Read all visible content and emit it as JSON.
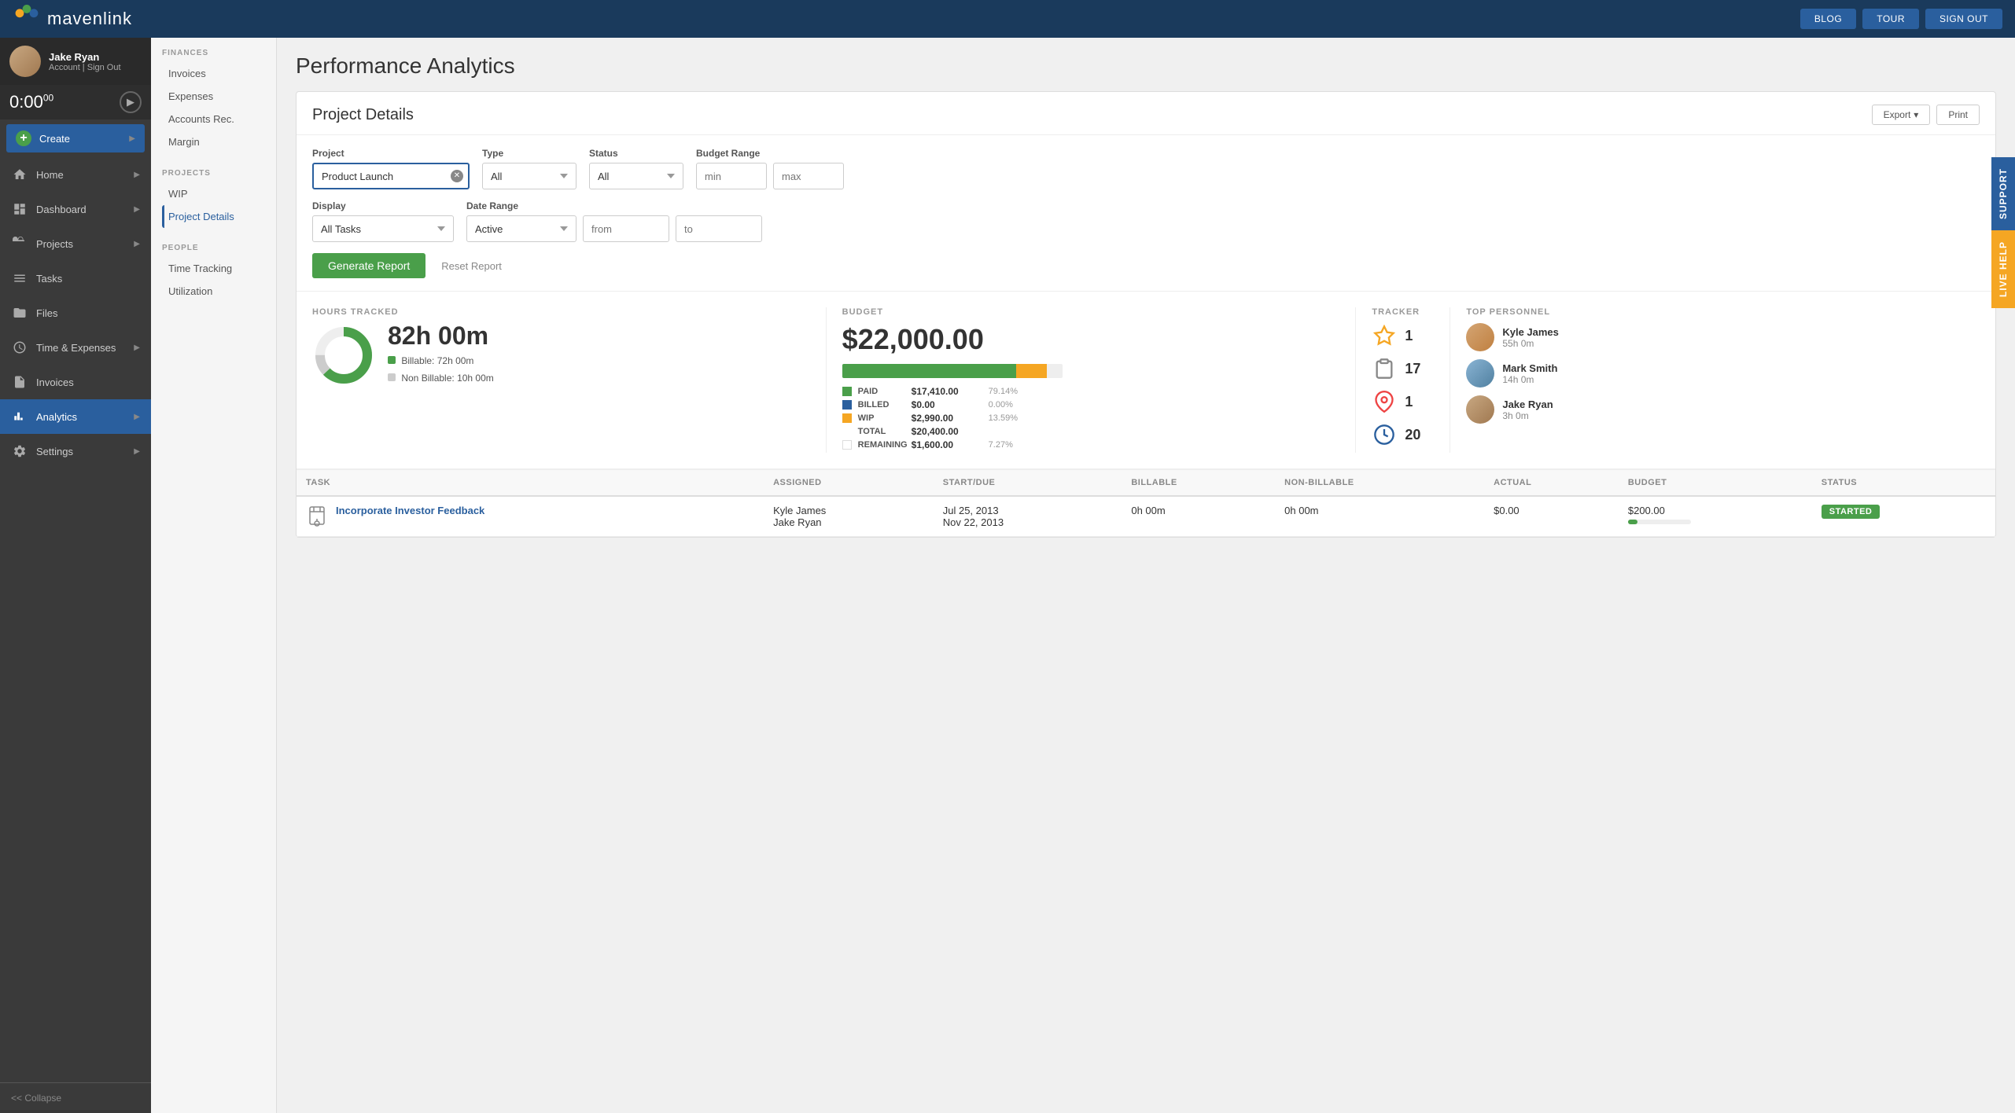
{
  "topNav": {
    "logoText": "mavenlink",
    "buttons": [
      "BLOG",
      "TOUR",
      "SIGN OUT"
    ]
  },
  "user": {
    "name": "Jake Ryan",
    "links": [
      "Account",
      "Sign Out"
    ]
  },
  "timer": {
    "display": "0:00",
    "seconds": "00"
  },
  "nav": {
    "items": [
      {
        "id": "create",
        "label": "Create",
        "hasArrow": true
      },
      {
        "id": "home",
        "label": "Home",
        "hasArrow": true
      },
      {
        "id": "dashboard",
        "label": "Dashboard",
        "hasArrow": true
      },
      {
        "id": "projects",
        "label": "Projects",
        "hasArrow": true
      },
      {
        "id": "tasks",
        "label": "Tasks",
        "hasArrow": false
      },
      {
        "id": "files",
        "label": "Files",
        "hasArrow": false
      },
      {
        "id": "time-expenses",
        "label": "Time & Expenses",
        "hasArrow": true
      },
      {
        "id": "invoices",
        "label": "Invoices",
        "hasArrow": false
      },
      {
        "id": "analytics",
        "label": "Analytics",
        "hasArrow": true,
        "active": true
      },
      {
        "id": "settings",
        "label": "Settings",
        "hasArrow": true
      }
    ],
    "collapse": "<< Collapse"
  },
  "subNav": {
    "finances": {
      "label": "FINANCES",
      "items": [
        "Invoices",
        "Expenses",
        "Accounts Rec.",
        "Margin"
      ]
    },
    "projects": {
      "label": "PROJECTS",
      "items": [
        "WIP",
        "Project Details"
      ]
    },
    "people": {
      "label": "PEOPLE",
      "items": [
        "Time Tracking",
        "Utilization"
      ]
    }
  },
  "page": {
    "title": "Performance Analytics"
  },
  "projectDetails": {
    "title": "Project Details",
    "actions": {
      "export": "Export",
      "print": "Print"
    },
    "filters": {
      "project": {
        "label": "Project",
        "value": "Product Launch",
        "placeholder": "Product Launch"
      },
      "type": {
        "label": "Type",
        "value": "All",
        "options": [
          "All"
        ]
      },
      "status": {
        "label": "Status",
        "value": "All",
        "options": [
          "All"
        ]
      },
      "budgetRange": {
        "label": "Budget Range",
        "minPlaceholder": "min",
        "maxPlaceholder": "max"
      },
      "display": {
        "label": "Display",
        "value": "All Tasks",
        "options": [
          "All Tasks"
        ]
      },
      "dateRange": {
        "label": "Date Range",
        "value": "Active",
        "fromPlaceholder": "from",
        "toPlaceholder": "to",
        "options": [
          "Active"
        ]
      }
    },
    "buttons": {
      "generate": "Generate Report",
      "reset": "Reset Report"
    }
  },
  "stats": {
    "hoursTracked": {
      "label": "HOURS TRACKED",
      "total": "82h 00m",
      "billable": "72h 00m",
      "nonBillable": "10h 00m",
      "billablePct": 87.8,
      "nonBillablePct": 12.2
    },
    "budget": {
      "label": "BUDGET",
      "total": "$22,000.00",
      "paid": {
        "label": "PAID",
        "amount": "$17,410.00",
        "pct": "79.14%",
        "barPct": 79
      },
      "billed": {
        "label": "BILLED",
        "amount": "$0.00",
        "pct": "0.00%",
        "barPct": 0
      },
      "wip": {
        "label": "WIP",
        "amount": "$2,990.00",
        "pct": "13.59%",
        "barPct": 14
      },
      "totalRow": {
        "label": "TOTAL",
        "amount": "$20,400.00"
      },
      "remaining": {
        "label": "REMAINING",
        "amount": "$1,600.00",
        "pct": "7.27%"
      }
    },
    "tracker": {
      "label": "TRACKER",
      "items": [
        {
          "icon": "star",
          "count": 1
        },
        {
          "icon": "clipboard",
          "count": 17
        },
        {
          "icon": "pin",
          "count": 1
        },
        {
          "icon": "clock",
          "count": 20
        }
      ]
    },
    "topPersonnel": {
      "label": "TOP PERSONNEL",
      "people": [
        {
          "name": "Kyle James",
          "hours": "55h 0m",
          "avatar": "kyle"
        },
        {
          "name": "Mark Smith",
          "hours": "14h 0m",
          "avatar": "mark"
        },
        {
          "name": "Jake Ryan",
          "hours": "3h 0m",
          "avatar": "jake"
        }
      ]
    }
  },
  "table": {
    "columns": [
      "TASK",
      "ASSIGNED",
      "START/DUE",
      "BILLABLE",
      "NON-BILLABLE",
      "ACTUAL",
      "BUDGET",
      "STATUS"
    ],
    "rows": [
      {
        "task": "Incorporate Investor Feedback",
        "assigned": [
          "Kyle James",
          "Jake Ryan"
        ],
        "startDate": "Jul 25, 2013",
        "dueDate": "Nov 22, 2013",
        "billable": "0h 00m",
        "nonBillable": "0h 00m",
        "actual": "$0.00",
        "budget": "$200.00",
        "status": "STARTED",
        "progress": 15
      }
    ]
  },
  "sideTabs": {
    "support": "SUPPORT",
    "liveHelp": "LIVE HELP"
  }
}
